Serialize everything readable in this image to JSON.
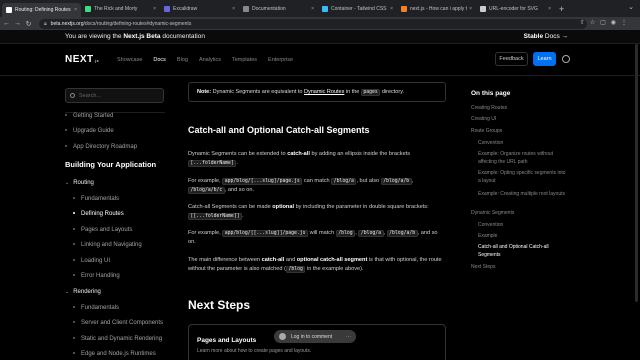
{
  "browser": {
    "tabs": [
      {
        "title": "Routing: Defining Routes | Ne...",
        "active": true,
        "color": "#ffffff"
      },
      {
        "title": "The Rick and Morty",
        "active": false,
        "color": "#3ddc84"
      },
      {
        "title": "Excalidraw",
        "active": false,
        "color": "#6965db"
      },
      {
        "title": "Documentation",
        "active": false,
        "color": "#888888"
      },
      {
        "title": "Container - Tailwind CSS",
        "active": false,
        "color": "#38bdf8"
      },
      {
        "title": "next.js - How can i apply tailw...",
        "active": false,
        "color": "#f48024"
      },
      {
        "title": "URL-encoder for SVG",
        "active": false,
        "color": "#cccccc"
      }
    ],
    "tab_close": "×",
    "new_tab": "+",
    "window_controls": "⌄",
    "url_host": "beta.nextjs.org",
    "url_path": "/docs/routing/defining-routes#dynamic-segments",
    "right_icons": "⇧☆▢◉⋮"
  },
  "banner": {
    "message_prefix": "You are viewing the ",
    "message_bold": "Next.js Beta",
    "message_suffix": " documentation",
    "stable_bold": "Stable",
    "stable_rest": " Docs →"
  },
  "header": {
    "logo": "NEXT",
    "logo_suffix": ".js",
    "nav": [
      "Showcase",
      "Docs",
      "Blog",
      "Analytics",
      "Templates",
      "Enterprise"
    ],
    "nav_active": "Docs",
    "feedback": "Feedback",
    "learn": "Learn"
  },
  "sidebar": {
    "search_placeholder": "Search...",
    "top_items": [
      "Getting Started",
      "Upgrade Guide",
      "App Directory Roadmap"
    ],
    "section_title": "Building Your Application",
    "group1": "Routing",
    "group1_items": [
      "Fundamentals",
      "Defining Routes",
      "Pages and Layouts",
      "Linking and Navigating",
      "Loading UI",
      "Error Handling"
    ],
    "active_item": "Defining Routes",
    "group2": "Rendering",
    "group2_items": [
      "Fundamentals",
      "Server and Client Components",
      "Static and Dynamic Rendering",
      "Edge and Node.js Runtimes"
    ]
  },
  "main": {
    "note_label": "Note:",
    "note_text1": " Dynamic Segments are equivalent to ",
    "note_link": "Dynamic Routes",
    "note_text2": " in the ",
    "note_code": "pages",
    "note_text3": " directory.",
    "h2": "Catch-all and Optional Catch-all Segments",
    "p1_a": "Dynamic Segments can be extended to ",
    "p1_b": "catch-all",
    "p1_c": " by adding an ellipsis inside the brackets ",
    "p1_code": "[...folderName]",
    "p1_d": ".",
    "p2_a": "For example, ",
    "p2_code1": "app/blog/[...slug]/page.js",
    "p2_b": " can match ",
    "p2_code2": "/blog/a",
    "p2_c": ", but also ",
    "p2_code3": "/blog/a/b",
    "p2_d": ", ",
    "p2_code4": "/blog/a/b/c",
    "p2_e": ", and so on.",
    "p3_a": "Catch-all Segments can be made ",
    "p3_b": "optional",
    "p3_c": " by including the parameter in double square brackets: ",
    "p3_code": "[[...folderName]]",
    "p3_d": ".",
    "p4_a": "For example, ",
    "p4_code1": "app/blog/[[...slug]]/page.js",
    "p4_b": " will match ",
    "p4_code2": "/blog",
    "p4_c": ", ",
    "p4_code3": "/blog/a",
    "p4_d": ", ",
    "p4_code4": "/blog/a/b",
    "p4_e": ", and so on.",
    "p5_a": "The main difference between ",
    "p5_b": "catch-all",
    "p5_c": " and ",
    "p5_d": "optional catch-all segment",
    "p5_e": " is that with optional, the route without the parameter is also matched (",
    "p5_code": "/blog",
    "p5_f": " in the example above).",
    "next_steps": "Next Steps",
    "card_title": "Pages and Layouts",
    "card_sub": "Learn more about how to create pages and layouts.",
    "toast": "Log in to comment",
    "toast_more": "···"
  },
  "toc": {
    "title": "On this page",
    "items": [
      "Creating Routes",
      "Creating UI",
      "Route Groups",
      "Convention",
      "Example: Organize routes without affecting the URL path",
      "Example: Opting specific segments into a layout",
      "Example: Creating multiple root layouts",
      "Dynamic Segments",
      "Convention",
      "Example",
      "Catch-all and Optional Catch-all Segments",
      "Next Steps"
    ],
    "active": "Catch-all and Optional Catch-all Segments"
  },
  "colors": {
    "accent": "#0070f3",
    "background": "#000000"
  }
}
